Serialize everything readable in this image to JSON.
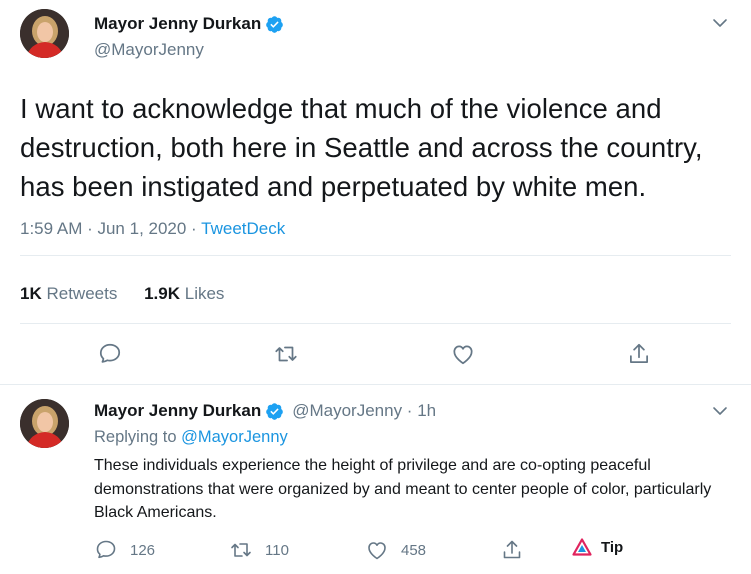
{
  "main_tweet": {
    "display_name": "Mayor Jenny Durkan",
    "handle": "@MayorJenny",
    "text": "I want to acknowledge that much of the violence and destruction, both here in Seattle and across the country, has been instigated and perpetuated by white men.",
    "timestamp": "1:59 AM · Jun 1, 2020 · ",
    "source": "TweetDeck",
    "retweets_count": "1K",
    "retweets_label": "Retweets",
    "likes_count": "1.9K",
    "likes_label": "Likes",
    "icons": [
      "reply-icon",
      "retweet-icon",
      "like-icon",
      "share-icon"
    ]
  },
  "reply_tweet": {
    "display_name": "Mayor Jenny Durkan",
    "handle_time": "@MayorJenny · 1h",
    "replying_prefix": "Replying to ",
    "replying_to": "@MayorJenny",
    "text": "These individuals experience the height of privilege and are co-opting peaceful demonstrations that were organized by and meant to center people of color, particularly Black Americans.",
    "reply_count": "126",
    "retweet_count": "110",
    "like_count": "458",
    "tip_label": "Tip"
  },
  "colors": {
    "verified": "#1da1f2",
    "link": "#1b95e0",
    "muted": "#657786",
    "tip_icon": "#e0245e"
  }
}
